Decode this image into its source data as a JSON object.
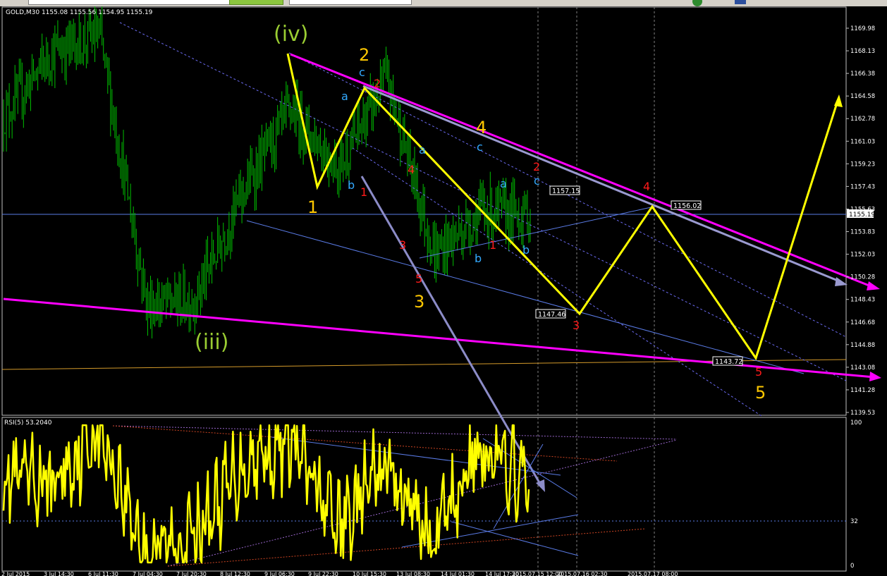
{
  "toolbar": {
    "controls": [
      "toolbar-box-1",
      "toolbar-green-button",
      "toolbar-box-2",
      "toolbar-circle",
      "toolbar-square"
    ]
  },
  "main_panel": {
    "title": "GOLD,M30  1155.08 1155.56 1154.95 1155.19",
    "price_ticks": [
      "1169.98",
      "1168.13",
      "1166.38",
      "1164.58",
      "1162.78",
      "1161.03",
      "1159.23",
      "1157.43",
      "1155.63",
      "1153.83",
      "1152.03",
      "1150.28",
      "1148.43",
      "1146.68",
      "1144.88",
      "1143.08",
      "1141.28",
      "1139.53"
    ],
    "current_price": "1155.19",
    "price_callouts": [
      "1157.15",
      "1156.02",
      "1147.46",
      "1143.72"
    ],
    "wave_labels": {
      "green": [
        "(iv)",
        "(iii)"
      ],
      "orange": [
        "2",
        "1",
        "4",
        "3",
        "5"
      ],
      "red": [
        "2",
        "1",
        "4",
        "3",
        "1",
        "2",
        "3",
        "4",
        "5",
        "5"
      ],
      "blue": [
        "c",
        "a",
        "b",
        "a",
        "c",
        "a",
        "c",
        "b",
        "b"
      ]
    }
  },
  "rsi_panel": {
    "title": "RSI(5) 53.2040",
    "ticks": [
      "100",
      "32",
      "0"
    ]
  },
  "time_axis": [
    "2 Jul 2015",
    "3 Jul 14:30",
    "6 Jul 11:30",
    "7 Jul 04:30",
    "7 Jul 20:30",
    "8 Jul 12:30",
    "9 Jul 06:30",
    "9 Jul 22:30",
    "10 Jul 15:30",
    "13 Jul 08:30",
    "14 Jul 01:30",
    "14 Jul 17:30",
    "2015.07.15 12:00",
    "2015.07.16 02:30",
    "2015.07.17 08:00"
  ],
  "colors": {
    "candle": "#00c000",
    "wave_path": "#ffff00",
    "channel": "#ff00ff",
    "trend_gray": "#8c8cc8",
    "thin_blue": "#5a7be6",
    "orange_label": "#ffc800",
    "green_label": "#9acd32",
    "red_label": "#ff1a1a",
    "blue_label": "#33aaff",
    "rsi_line": "#ffff00"
  },
  "chart_data": [
    {
      "type": "line",
      "title": "GOLD,M30  1155.08 1155.56 1154.95 1155.19",
      "ylim": [
        1139.53,
        1169.98
      ],
      "x": [
        "2 Jul 2015",
        "3 Jul 14:30",
        "6 Jul 11:30",
        "7 Jul 04:30",
        "7 Jul 20:30",
        "8 Jul 12:30",
        "9 Jul 06:30",
        "9 Jul 22:30",
        "10 Jul 15:30",
        "13 Jul 08:30",
        "14 Jul 01:30",
        "14 Jul 17:30"
      ],
      "series": [
        {
          "name": "",
          "values": [
            1163.0,
            1168.0,
            1169.5,
            1148.0,
            1148.5,
            1157.0,
            1163.5,
            1159.0,
            1166.0,
            1152.0,
            1155.5,
            1155.19
          ]
        }
      ]
    },
    {
      "type": "line",
      "title": "RSI(5) 53.2040",
      "ylim": [
        0,
        100
      ],
      "x": [
        "2 Jul 2015",
        "3 Jul 14:30",
        "6 Jul 11:30",
        "7 Jul 04:30",
        "7 Jul 20:30",
        "8 Jul 12:30",
        "9 Jul 06:30",
        "9 Jul 22:30",
        "10 Jul 15:30",
        "13 Jul 08:30",
        "14 Jul 01:30",
        "14 Jul 17:30"
      ],
      "series": [
        {
          "name": "",
          "values": [
            62,
            55,
            95,
            8,
            20,
            70,
            88,
            25,
            70,
            18,
            85,
            53.2
          ]
        }
      ]
    }
  ]
}
